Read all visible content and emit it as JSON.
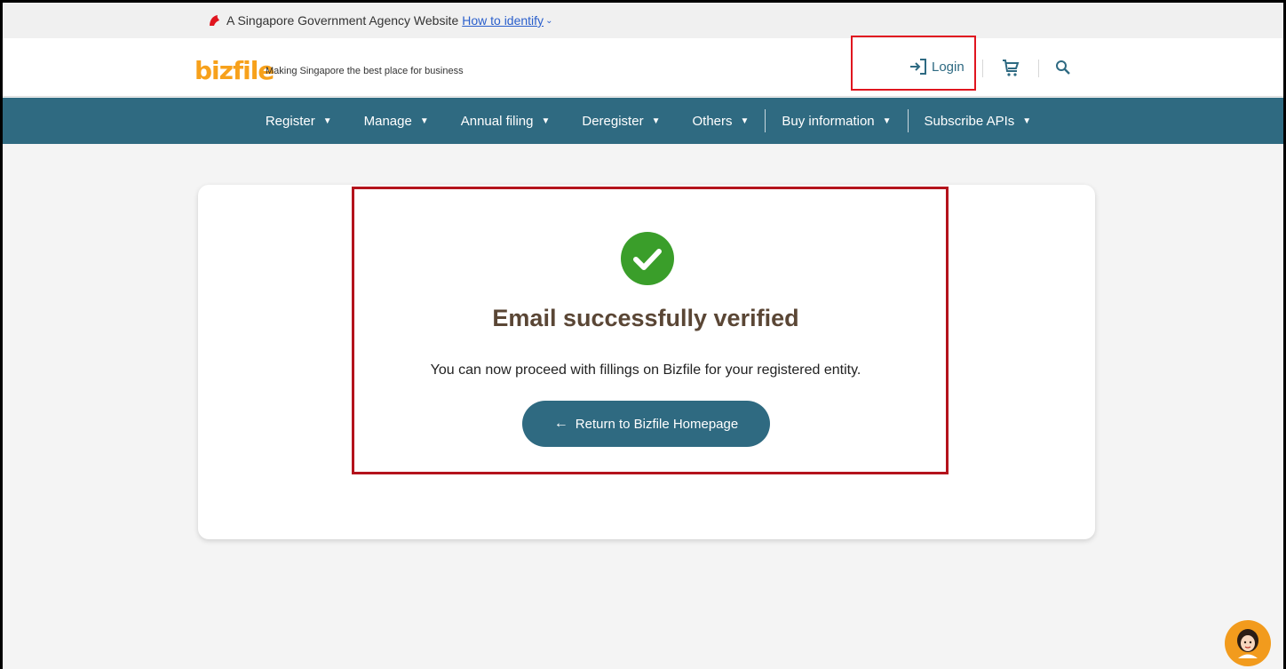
{
  "masthead": {
    "text": "A Singapore Government Agency Website",
    "link": "How to identify"
  },
  "header": {
    "logo": "bizfile",
    "tagline": "Making Singapore the best place for business",
    "login_label": "Login"
  },
  "nav": {
    "items": [
      {
        "label": "Register"
      },
      {
        "label": "Manage"
      },
      {
        "label": "Annual filing"
      },
      {
        "label": "Deregister"
      },
      {
        "label": "Others"
      },
      {
        "label": "Buy information"
      },
      {
        "label": "Subscribe APIs"
      }
    ]
  },
  "main": {
    "title": "Email successfully verified",
    "message": "You can now proceed with fillings on Bizfile for your registered entity.",
    "button_label": "Return to Bizfile Homepage"
  },
  "colors": {
    "primary": "#2f6a81",
    "logo": "#f7a11b",
    "success": "#3a9e2a",
    "highlight": "#e0151f"
  },
  "icons": {
    "masthead": "lion-head-icon",
    "login": "login-icon",
    "cart": "cart-icon",
    "search": "search-icon",
    "success": "check-circle-icon",
    "button": "arrow-left-icon",
    "chat": "chat-avatar-icon"
  }
}
